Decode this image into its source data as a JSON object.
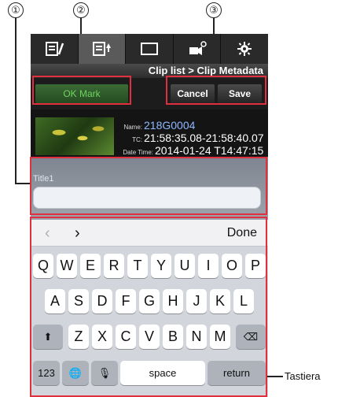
{
  "callouts": {
    "c1": "①",
    "c2": "②",
    "c3": "③"
  },
  "header": {
    "breadcrumb": "Clip list > Clip Metadata"
  },
  "tabs": [
    {
      "icon": "edit-list-icon"
    },
    {
      "icon": "clip-list-icon",
      "active": true
    },
    {
      "icon": "monitor-icon"
    },
    {
      "icon": "camera-settings-icon"
    },
    {
      "icon": "gear-icon"
    }
  ],
  "buttons": {
    "ok_mark": "OK Mark",
    "cancel": "Cancel",
    "save": "Save"
  },
  "clip": {
    "name_key": "Name:",
    "name": "218G0004",
    "tc_key": "TC:",
    "tc": "21:58:35.08-21:58:40.07",
    "datetime_key": "Date Time:",
    "datetime": "2014-01-24 T14:47:15"
  },
  "form": {
    "label": "Title1",
    "value": ""
  },
  "keyboard": {
    "prev": "‹",
    "next": "›",
    "done": "Done",
    "row1": [
      "Q",
      "W",
      "E",
      "R",
      "T",
      "Y",
      "U",
      "I",
      "O",
      "P"
    ],
    "row2": [
      "A",
      "S",
      "D",
      "F",
      "G",
      "H",
      "J",
      "K",
      "L"
    ],
    "row3": [
      "Z",
      "X",
      "C",
      "V",
      "B",
      "N",
      "M"
    ],
    "shift": "⬆",
    "delete": "⌫",
    "numbers": "123",
    "globe": "🌐",
    "mic": "🎙",
    "space": "space",
    "return": "return"
  },
  "annotation": {
    "keyboard_label": "Tastiera"
  },
  "colors": {
    "highlight": "#e03040",
    "ok_text": "#6fd35f",
    "name_text": "#8fb8ff"
  }
}
